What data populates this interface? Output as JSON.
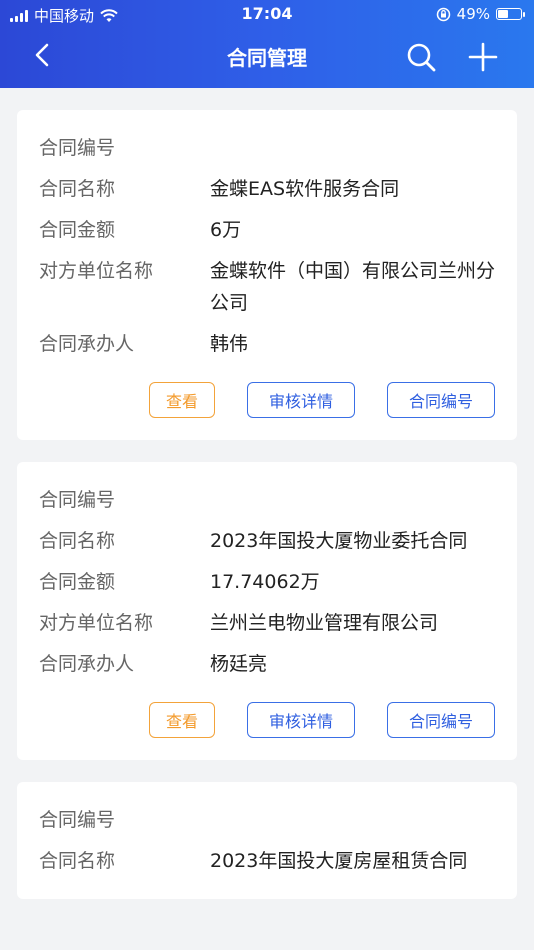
{
  "status": {
    "carrier": "中国移动",
    "time": "17:04",
    "battery": "49%",
    "battery_level": 0.49
  },
  "nav": {
    "title": "合同管理"
  },
  "labels": {
    "number": "合同编号",
    "name": "合同名称",
    "amount": "合同金额",
    "party": "对方单位名称",
    "handler": "合同承办人"
  },
  "buttons": {
    "view": "查看",
    "audit": "审核详情",
    "number": "合同编号"
  },
  "contracts": [
    {
      "number": "",
      "name": "金蝶EAS软件服务合同",
      "amount": "6万",
      "party": "金蝶软件（中国）有限公司兰州分公司",
      "handler": "韩伟"
    },
    {
      "number": "",
      "name": "2023年国投大厦物业委托合同",
      "amount": "17.74062万",
      "party": "兰州兰电物业管理有限公司",
      "handler": "杨廷亮"
    },
    {
      "number": "",
      "name": "2023年国投大厦房屋租赁合同",
      "amount": "",
      "party": "",
      "handler": ""
    }
  ]
}
